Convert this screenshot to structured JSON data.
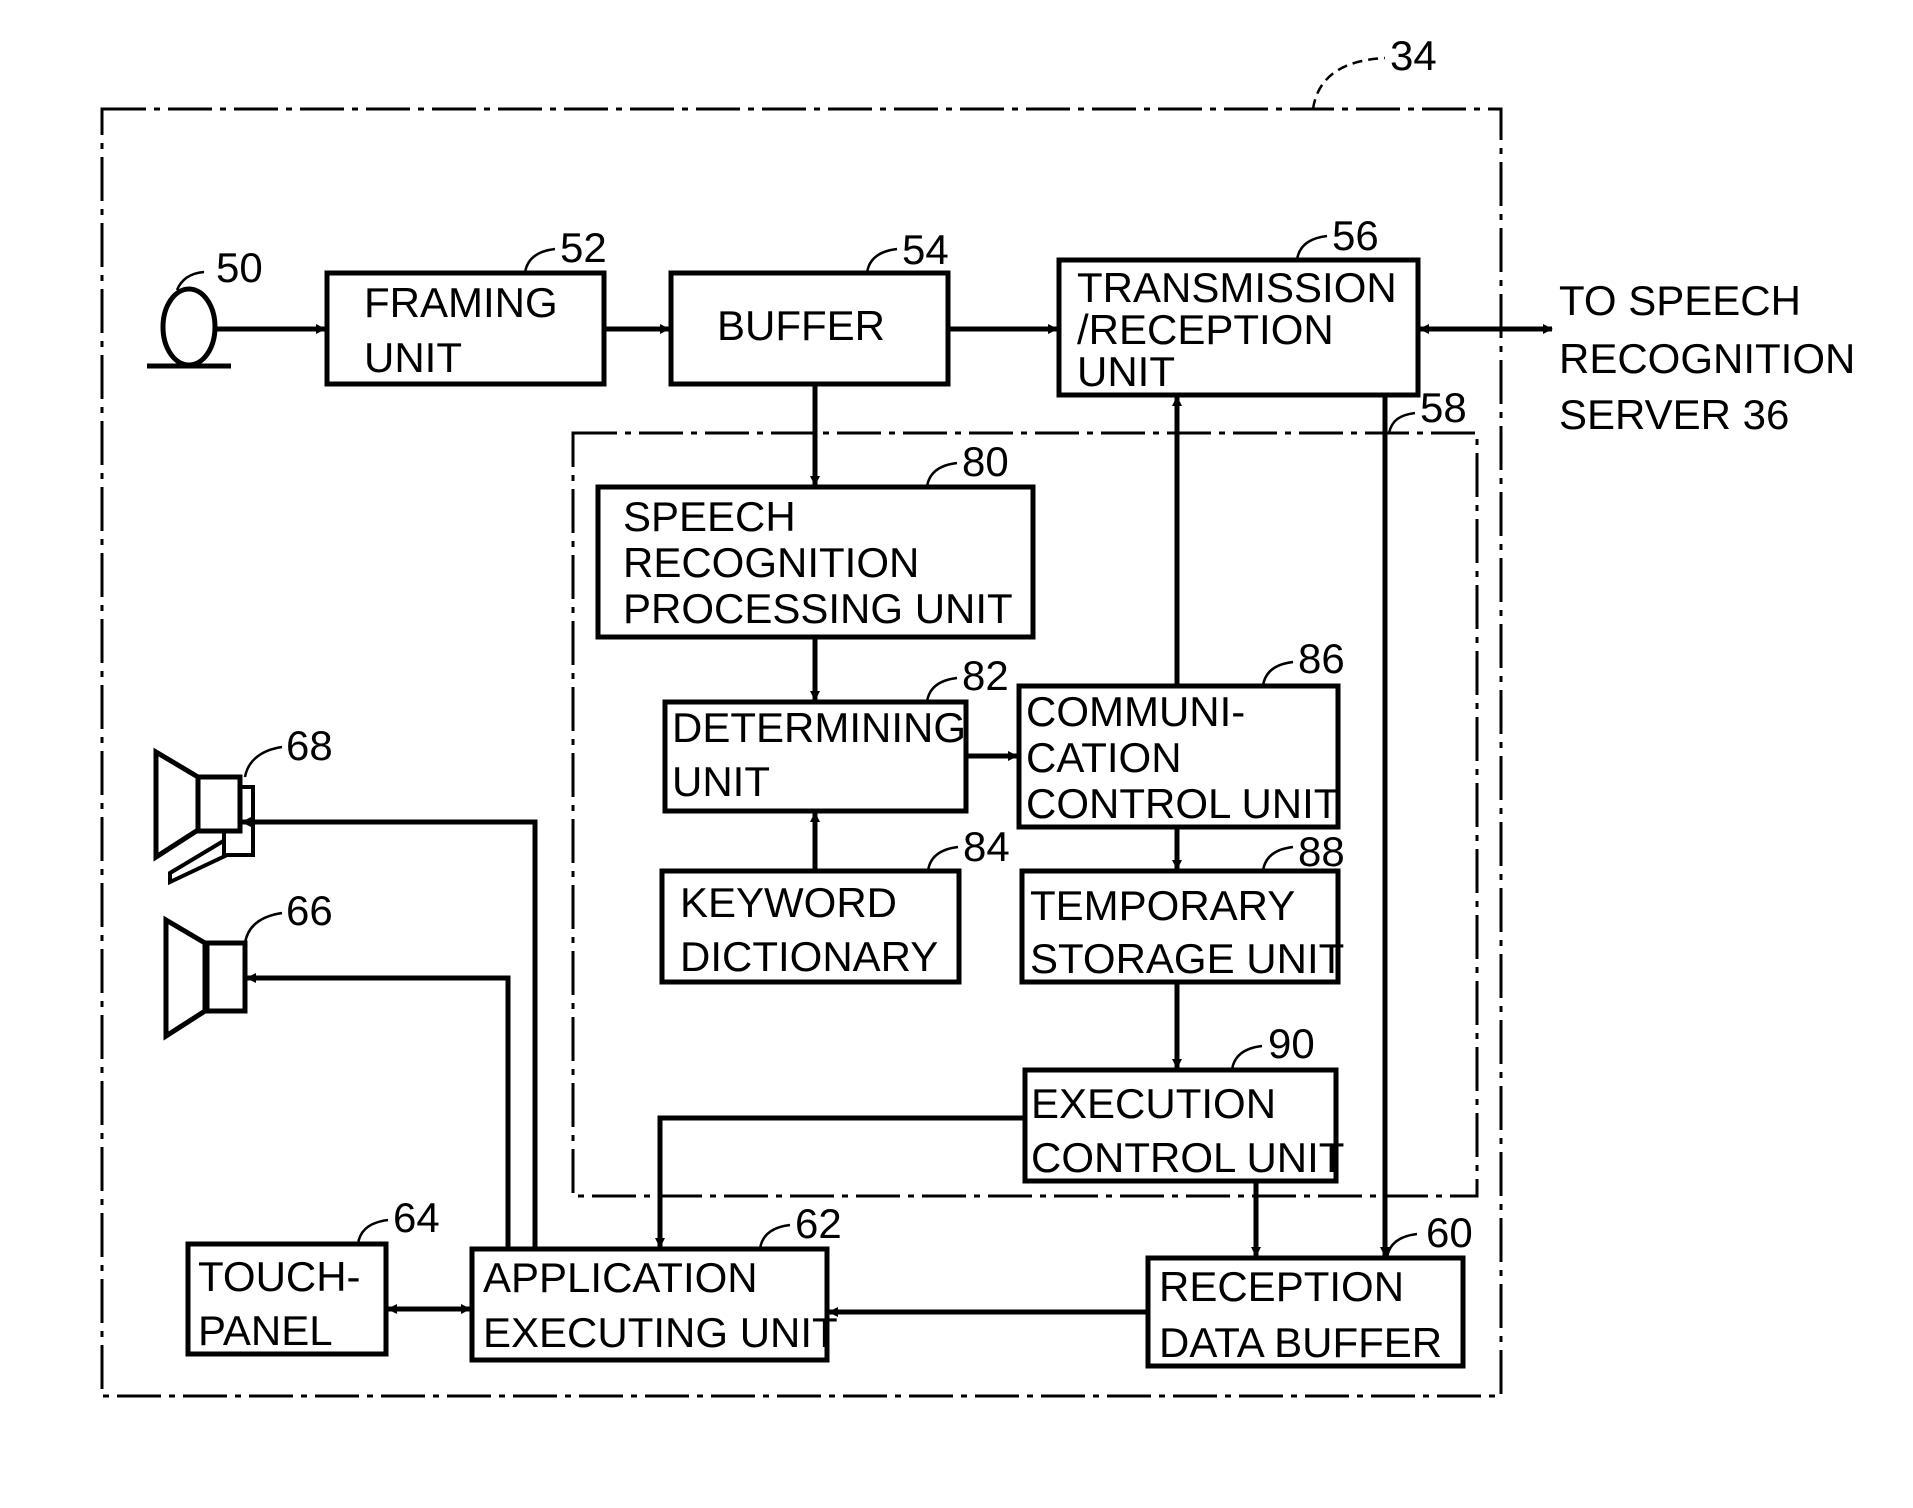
{
  "diagram": {
    "outer_block": {
      "ref": "34"
    },
    "inner_block": {
      "ref": "58"
    },
    "external": {
      "lines": [
        "TO SPEECH",
        "RECOGNITION",
        "SERVER 36"
      ]
    },
    "microphone": {
      "ref": "50",
      "icon": "microphone-icon"
    },
    "speaker_68": {
      "ref": "68",
      "icon": "speaker-icon"
    },
    "speaker_66": {
      "ref": "66",
      "icon": "speaker-icon"
    },
    "blocks": {
      "framing": {
        "ref": "52",
        "lines": [
          "FRAMING",
          "UNIT"
        ]
      },
      "buffer": {
        "ref": "54",
        "lines": [
          "BUFFER"
        ]
      },
      "transmission": {
        "ref": "56",
        "lines": [
          "TRANSMISSION",
          "/RECEPTION",
          "UNIT"
        ]
      },
      "speech_recognition": {
        "ref": "80",
        "lines": [
          "SPEECH",
          "RECOGNITION",
          "PROCESSING UNIT"
        ]
      },
      "determining": {
        "ref": "82",
        "lines": [
          "DETERMINING",
          "UNIT"
        ]
      },
      "keyword_dictionary": {
        "ref": "84",
        "lines": [
          "KEYWORD",
          "DICTIONARY"
        ]
      },
      "communication_control": {
        "ref": "86",
        "lines": [
          "COMMUNI-",
          "CATION",
          "CONTROL UNIT"
        ]
      },
      "temporary_storage": {
        "ref": "88",
        "lines": [
          "TEMPORARY",
          "STORAGE UNIT"
        ]
      },
      "execution_control": {
        "ref": "90",
        "lines": [
          "EXECUTION",
          "CONTROL UNIT"
        ]
      },
      "touch_panel": {
        "ref": "64",
        "lines": [
          "TOUCH-",
          "PANEL"
        ]
      },
      "application_executing": {
        "ref": "62",
        "lines": [
          "APPLICATION",
          "EXECUTING UNIT"
        ]
      },
      "reception_data_buffer": {
        "ref": "60",
        "lines": [
          "RECEPTION",
          "DATA BUFFER"
        ]
      }
    },
    "connections": [
      {
        "from": "microphone",
        "to": "framing",
        "direction": "forward"
      },
      {
        "from": "framing",
        "to": "buffer",
        "direction": "forward"
      },
      {
        "from": "buffer",
        "to": "transmission",
        "direction": "forward"
      },
      {
        "from": "transmission",
        "to": "external",
        "direction": "bidirectional"
      },
      {
        "from": "buffer",
        "to": "speech_recognition",
        "direction": "forward"
      },
      {
        "from": "speech_recognition",
        "to": "determining",
        "direction": "forward"
      },
      {
        "from": "keyword_dictionary",
        "to": "determining",
        "direction": "forward"
      },
      {
        "from": "determining",
        "to": "communication_control",
        "direction": "forward"
      },
      {
        "from": "communication_control",
        "to": "transmission",
        "direction": "forward"
      },
      {
        "from": "communication_control",
        "to": "temporary_storage",
        "direction": "forward"
      },
      {
        "from": "temporary_storage",
        "to": "execution_control",
        "direction": "forward"
      },
      {
        "from": "execution_control",
        "to": "application_executing",
        "direction": "forward"
      },
      {
        "from": "execution_control",
        "to": "reception_data_buffer",
        "direction": "forward"
      },
      {
        "from": "transmission",
        "to": "reception_data_buffer",
        "direction": "forward"
      },
      {
        "from": "reception_data_buffer",
        "to": "application_executing",
        "direction": "forward"
      },
      {
        "from": "touch_panel",
        "to": "application_executing",
        "direction": "bidirectional"
      },
      {
        "from": "application_executing",
        "to": "speaker_68",
        "direction": "forward"
      },
      {
        "from": "application_executing",
        "to": "speaker_66",
        "direction": "forward"
      }
    ]
  }
}
